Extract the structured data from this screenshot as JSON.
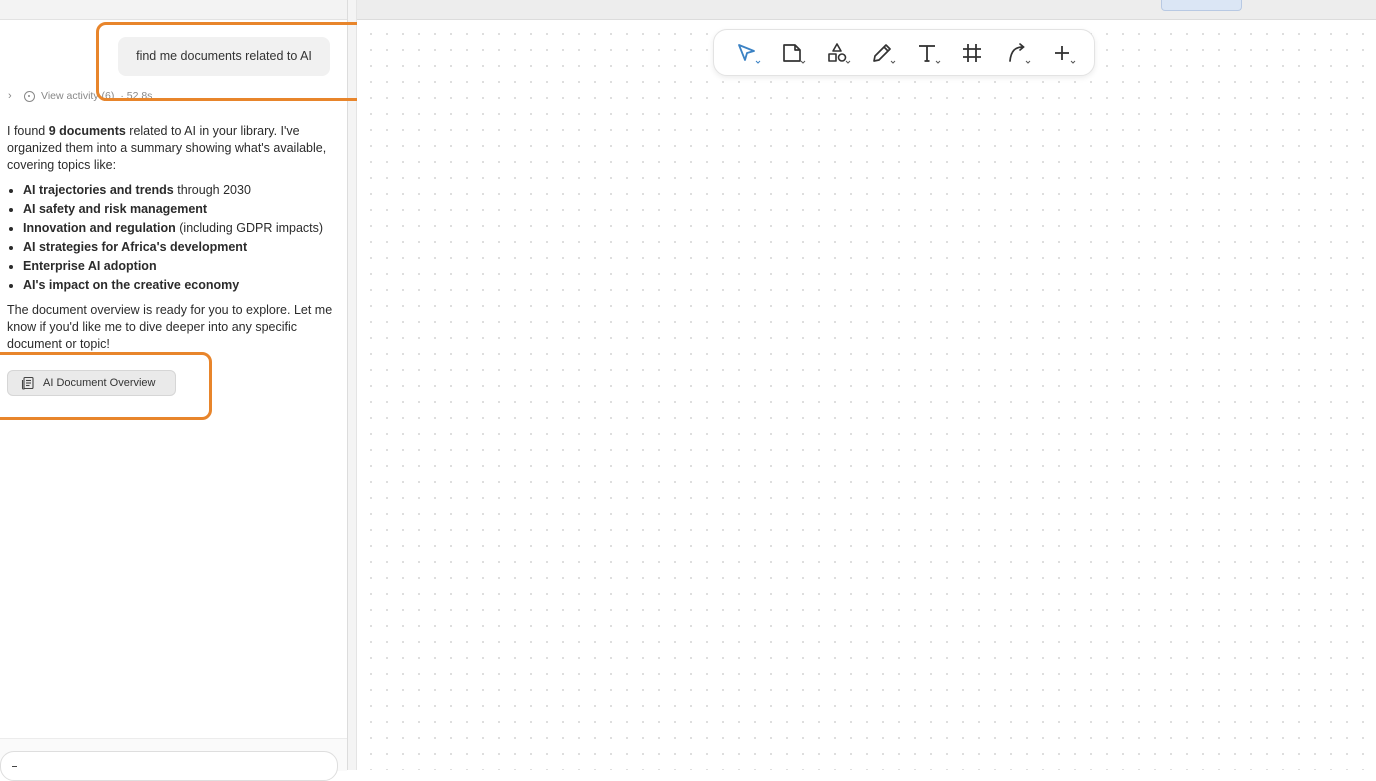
{
  "conversation": {
    "user_message": "find me documents related to AI",
    "activity": {
      "label": "View activity (6)",
      "duration": "· 52.8s"
    },
    "reply": {
      "intro_pre": "I found ",
      "intro_bold": "9 documents",
      "intro_post": " related to AI in your library. I've organized them into a summary showing what's available, covering topics like:",
      "topics": [
        {
          "bold": "AI trajectories and trends",
          "rest": " through 2030"
        },
        {
          "bold": "AI safety and risk management",
          "rest": ""
        },
        {
          "bold": "Innovation and regulation",
          "rest": " (including GDPR impacts)"
        },
        {
          "bold": "AI strategies for Africa's development",
          "rest": ""
        },
        {
          "bold": "Enterprise AI adoption",
          "rest": ""
        },
        {
          "bold": "AI's impact on the creative economy",
          "rest": ""
        }
      ],
      "outro": "The document overview is ready for you to explore. Let me know if you'd like me to dive deeper into any specific document or topic!"
    },
    "artifact_button": "AI Document Overview"
  },
  "toolbar": {
    "tools": [
      {
        "name": "select-tool",
        "icon": "cursor-arrow-icon",
        "active": true
      },
      {
        "name": "note-tool",
        "icon": "sticky-note-icon"
      },
      {
        "name": "shapes-tool",
        "icon": "shapes-icon"
      },
      {
        "name": "pen-tool",
        "icon": "pencil-icon"
      },
      {
        "name": "text-tool",
        "icon": "text-T-icon"
      },
      {
        "name": "frame-tool",
        "icon": "hash-frame-icon"
      },
      {
        "name": "connector-tool",
        "icon": "curved-arrow-icon"
      },
      {
        "name": "add-tool",
        "icon": "plus-icon"
      }
    ]
  },
  "colors": {
    "accent": "#3b82c4",
    "callout": "#e8852b",
    "canvas_dot": "#d6d6d6"
  }
}
